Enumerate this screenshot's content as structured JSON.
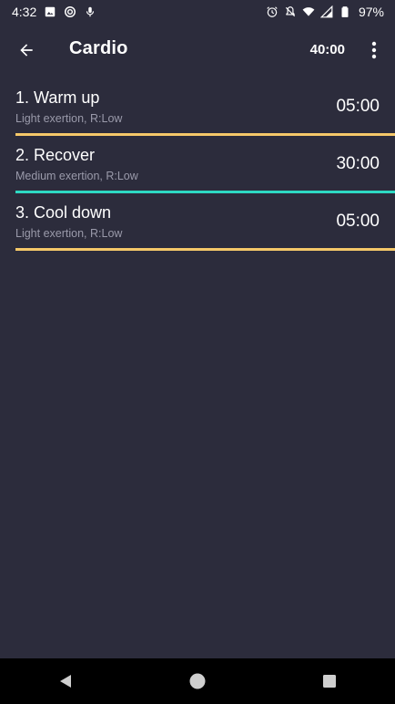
{
  "status_bar": {
    "time": "4:32",
    "battery": "97%",
    "left_icons": [
      "image-icon",
      "sync-icon",
      "mic-icon"
    ],
    "right_icons": [
      "alarm-icon",
      "notifications-off-icon",
      "wifi-icon",
      "signal-icon",
      "battery-icon"
    ]
  },
  "app_bar": {
    "title": "Cardio",
    "total_time": "40:00"
  },
  "steps": [
    {
      "name": "1. Warm up",
      "detail": "Light exertion, R:Low",
      "time": "05:00",
      "color": "#f5c869"
    },
    {
      "name": "2. Recover",
      "detail": "Medium exertion, R:Low",
      "time": "30:00",
      "color": "#2ed9c3"
    },
    {
      "name": "3. Cool down",
      "detail": "Light exertion, R:Low",
      "time": "05:00",
      "color": "#f5c869"
    }
  ],
  "colors": {
    "background": "#2c2c3c",
    "text_secondary": "#9a9aaa",
    "nav_bar": "#000000"
  },
  "nav_bar": {
    "buttons": [
      "back-triangle-icon",
      "home-circle-icon",
      "recents-square-icon"
    ]
  }
}
